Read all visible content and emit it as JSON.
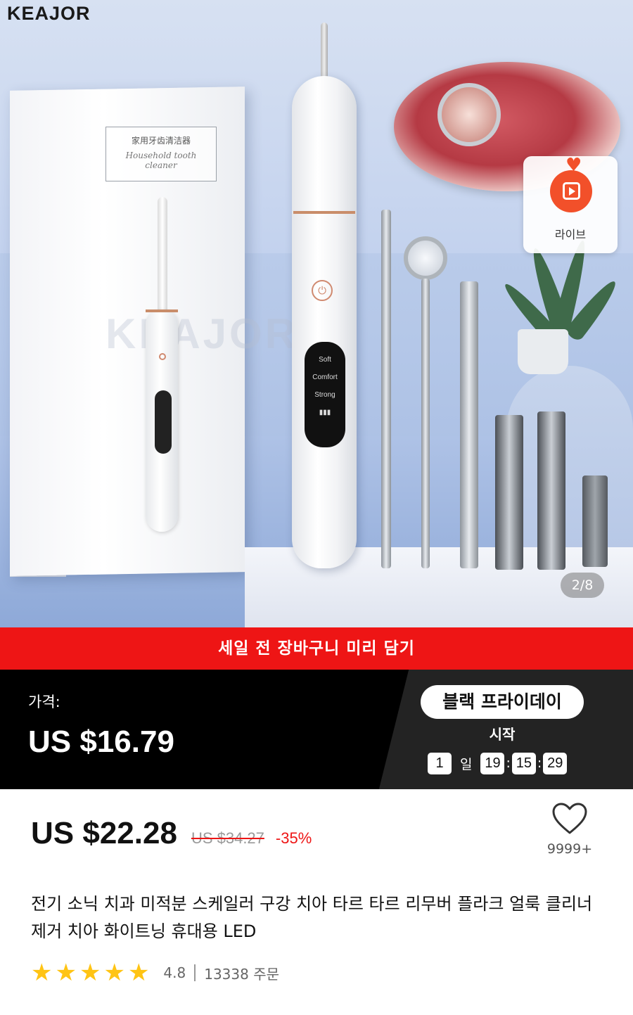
{
  "hero": {
    "brand_logo": "KEAJOR",
    "box_label_cn": "家用牙齿清洁器",
    "box_label_en": "Household tooth cleaner",
    "box_watermark": "KEAJOR",
    "device_modes": [
      "Soft",
      "Comfort",
      "Strong"
    ],
    "live_badge_label": "라이브",
    "image_counter": "2/8"
  },
  "promo_banner": "세일 전 장바구니 미리 담기",
  "deal": {
    "price_label": "가격:",
    "price": "US $16.79",
    "event_name": "블랙 프라이데이",
    "event_start_label": "시작",
    "countdown": {
      "days": "1",
      "day_unit": "일",
      "hours": "19",
      "minutes": "15",
      "seconds": "29"
    }
  },
  "pricing": {
    "current": "US $22.28",
    "original": "US $34.27",
    "discount": "-35%",
    "wishlist_count": "9999+"
  },
  "product_title": "전기 소닉 치과 미적분 스케일러 구강 치아 타르 타르 리무버 플라크 얼룩 클리너 제거 치아 화이트닝 휴대용 LED",
  "rating": {
    "stars": 5,
    "value": "4.8",
    "orders": "13338 주문"
  },
  "colors": {
    "promo_red": "#ee1515",
    "deal_black": "#000000",
    "star_yellow": "#ffc414",
    "live_orange": "#f2502a"
  }
}
